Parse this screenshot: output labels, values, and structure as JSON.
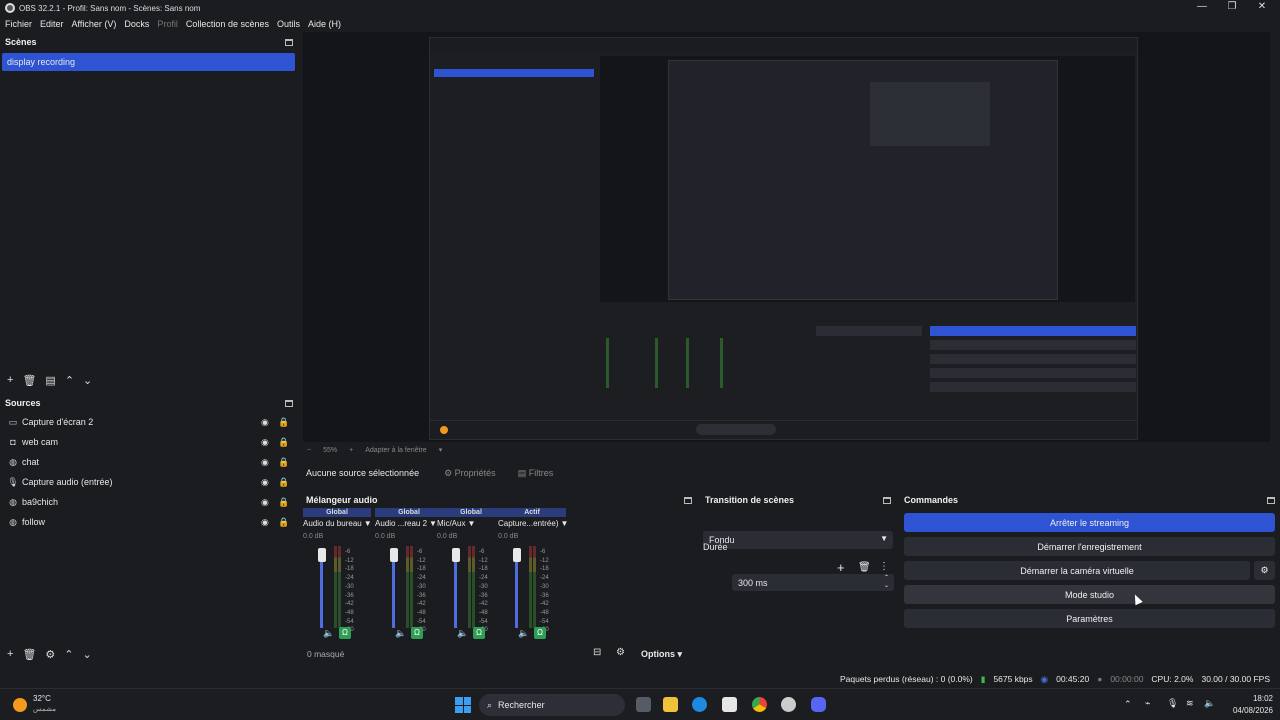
{
  "window": {
    "title": "OBS 32.2.1 - Profil: Sans nom - Scènes: Sans nom",
    "controls": [
      "—",
      "❐",
      "✕"
    ]
  },
  "menu": [
    "Fichier",
    "Editer",
    "Afficher (V)",
    "Docks",
    "Profil",
    "Collection de scènes",
    "Outils",
    "Aide (H)"
  ],
  "scenes": {
    "title": "Scènes",
    "items": [
      "display recording"
    ]
  },
  "sources": {
    "title": "Sources",
    "items": [
      {
        "label": "Capture d'écran 2",
        "icon": "monitor-icon"
      },
      {
        "label": "web cam",
        "icon": "camera-icon"
      },
      {
        "label": "chat",
        "icon": "globe-icon"
      },
      {
        "label": "Capture audio (entrée)",
        "icon": "microphone-icon"
      },
      {
        "label": "ba9chich",
        "icon": "globe-icon"
      },
      {
        "label": "follow",
        "icon": "globe-icon"
      }
    ]
  },
  "preview_bar": {
    "zoom": "55%",
    "fit": "Adapter à la fenêtre"
  },
  "context_bar": {
    "no_source": "Aucune source sélectionnée",
    "properties": "Propriétés",
    "filters": "Filtres"
  },
  "mixer": {
    "title": "Mélangeur audio",
    "channels": [
      {
        "badge": "Global",
        "name": "Audio du bureau",
        "db": "0.0 dB"
      },
      {
        "badge": "Global",
        "name": "Audio ...reau 2",
        "db": "0.0 dB"
      },
      {
        "badge": "Global",
        "name": "Mic/Aux",
        "db": "0.0 dB"
      },
      {
        "badge": "Actif",
        "name": "Capture...entrée)",
        "db": "0.0 dB"
      }
    ],
    "ticks": [
      "-6",
      "-12",
      "-18",
      "-24",
      "-30",
      "-36",
      "-42",
      "-48",
      "-54",
      "-60"
    ],
    "hidden": "0 masqué",
    "options": "Options"
  },
  "transitions": {
    "title": "Transition de scènes",
    "selected": "Fondu",
    "duration_label": "Durée",
    "duration_value": "300 ms"
  },
  "controls": {
    "title": "Commandes",
    "stop_streaming": "Arrêter le streaming",
    "start_recording": "Démarrer l'enregistrement",
    "start_virtual_cam": "Démarrer la caméra virtuelle",
    "studio_mode": "Mode studio",
    "settings": "Paramètres"
  },
  "status": {
    "dropped": "Paquets perdus (réseau) : 0 (0.0%)",
    "bitrate": "5675 kbps",
    "stream_time": "00:45:20",
    "record_time": "00:00:00",
    "cpu": "CPU: 2.0%",
    "fps": "30.00 / 30.00 FPS"
  },
  "taskbar": {
    "temperature": "32°C",
    "weather": "مشمس",
    "search": "Rechercher",
    "time": "18:02",
    "date": "04/08/2026"
  },
  "colors": {
    "accent": "#2f54d3",
    "background": "#1b1c20",
    "panel": "#2b2d34"
  }
}
